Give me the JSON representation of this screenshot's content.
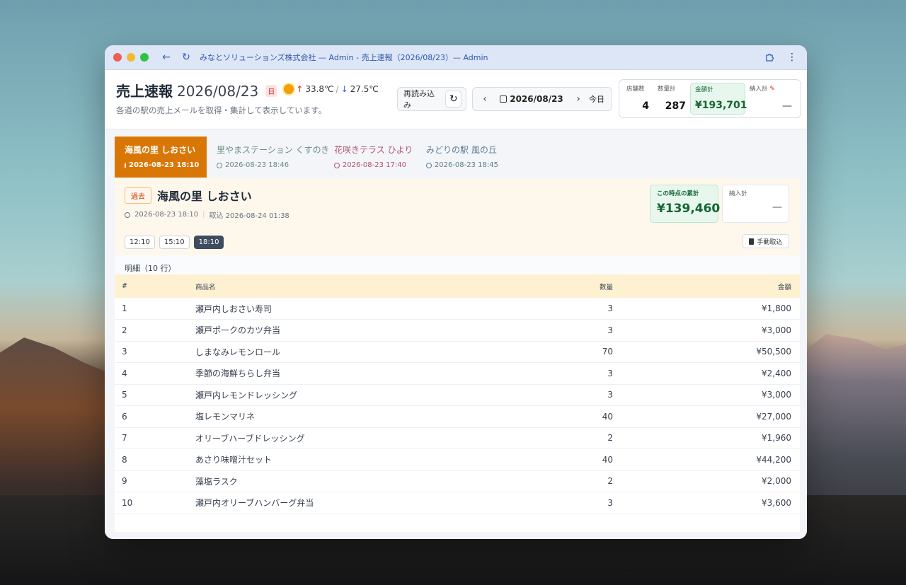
{
  "browser": {
    "title": "みなとソリューションズ株式会社 — Admin - 売上速報（2026/08/23）— Admin"
  },
  "header": {
    "title": "売上速報",
    "date": "2026/08/23",
    "day_of_week": "日",
    "temp_high": "33.8℃",
    "temp_sep": "/",
    "temp_low": "27.5℃",
    "subtitle": "各道の駅の売上メールを取得・集計して表示しています。",
    "reload_label": "再読み込み",
    "nav_date": "2026/08/23",
    "today_label": "今日"
  },
  "stats": {
    "stores_label": "店舗数",
    "stores_value": "4",
    "qty_label": "数量計",
    "qty_value": "287",
    "amount_label": "金額計",
    "amount_value": "¥193,701",
    "deliver_label": "納入計",
    "deliver_value": "—"
  },
  "tabs": [
    {
      "name": "海風の里 しおさい",
      "time": "2026-08-23 18:10"
    },
    {
      "name": "里やまステーション くすのき",
      "time": "2026-08-23 18:46"
    },
    {
      "name": "花咲きテラス ひより",
      "time": "2026-08-23 17:40"
    },
    {
      "name": "みどりの駅 風の丘",
      "time": "2026-08-23 18:45"
    }
  ],
  "store": {
    "badge": "過去",
    "name": "海風の里 しおさい",
    "timestamp": "2026-08-23 18:10",
    "sep": "|",
    "imported": "取込 2026-08-24 01:38",
    "slots": [
      "12:10",
      "15:10",
      "18:10"
    ],
    "cum_label": "この時点の累計",
    "cum_value": "¥139,460",
    "deliver_label": "納入計",
    "deliver_value": "—",
    "manual_label": "手動取込"
  },
  "detail": {
    "title": "明細（10 行）",
    "columns": [
      "#",
      "商品名",
      "数量",
      "金額"
    ],
    "rows": [
      [
        "1",
        "瀬戸内しおさい寿司",
        "3",
        "¥1,800"
      ],
      [
        "2",
        "瀬戸ポークのカツ弁当",
        "3",
        "¥3,000"
      ],
      [
        "3",
        "しまなみレモンロール",
        "70",
        "¥50,500"
      ],
      [
        "4",
        "季節の海鮮ちらし弁当",
        "3",
        "¥2,400"
      ],
      [
        "5",
        "瀬戸内レモンドレッシング",
        "3",
        "¥3,000"
      ],
      [
        "6",
        "塩レモンマリネ",
        "40",
        "¥27,000"
      ],
      [
        "7",
        "オリーブハーブドレッシング",
        "2",
        "¥1,960"
      ],
      [
        "8",
        "あさり味噌汁セット",
        "40",
        "¥44,200"
      ],
      [
        "9",
        "藻塩ラスク",
        "2",
        "¥2,000"
      ],
      [
        "10",
        "瀬戸内オリーブハンバーグ弁当",
        "3",
        "¥3,600"
      ]
    ]
  },
  "colors": {
    "accent_orange": "#d97706",
    "green": "#166534",
    "titlebar": "#dde6f6"
  }
}
